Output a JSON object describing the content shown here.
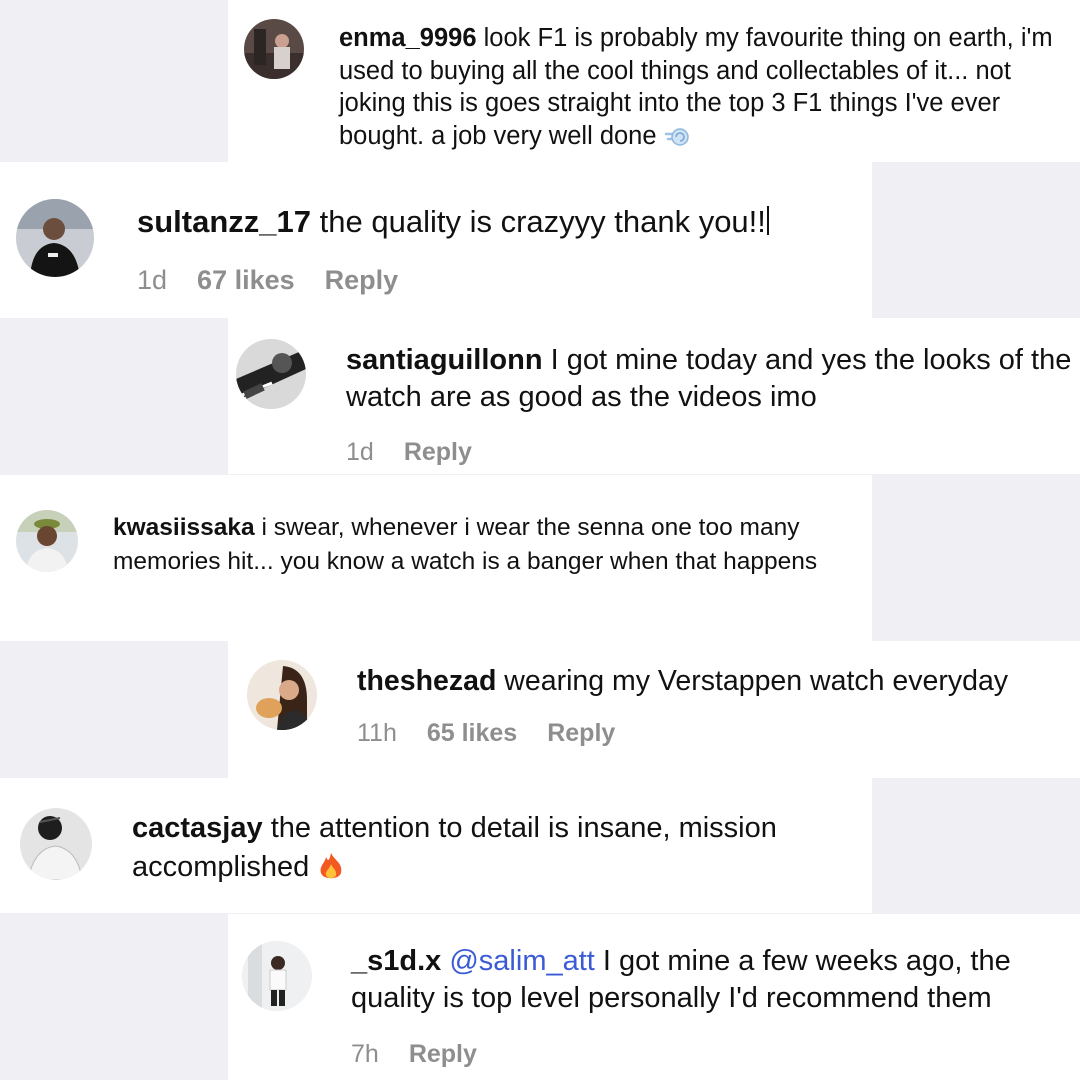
{
  "comments": [
    {
      "username": "enma_9996",
      "text": "look F1 is probably my favourite thing on earth, i'm used to buying all the cool things and collectables of it... not joking this is goes straight into the top 3 F1 things I've ever bought. a job very well done",
      "emoji": "dash-emoji"
    },
    {
      "username": "sultanzz_17",
      "text": "the quality is crazyyy thank you!!",
      "time": "1d",
      "likes": "67 likes",
      "reply": "Reply"
    },
    {
      "username": "santiaguillonn",
      "text": "I got mine today and yes the looks of the watch are as good as the videos imo",
      "time": "1d",
      "reply": "Reply"
    },
    {
      "username": "kwasiissaka",
      "text": "i swear, whenever i wear the senna one too many memories hit... you know a watch is a banger when that happens"
    },
    {
      "username": "theshezad",
      "text": "wearing my Verstappen watch everyday",
      "time": "11h",
      "likes": "65 likes",
      "reply": "Reply"
    },
    {
      "username": "cactasjay",
      "text": "the attention to detail is insane, mission accomplished",
      "emoji": "fire-emoji"
    },
    {
      "username": "_s1d.x",
      "mention": "@salim_att",
      "text": "I got mine a few weeks ago, the quality is top level personally I'd recommend them",
      "time": "7h",
      "reply": "Reply"
    }
  ],
  "colors": {
    "background": "#efeff4",
    "card": "#ffffff",
    "meta": "#8e8e8e",
    "mention": "#3b5bd6"
  }
}
